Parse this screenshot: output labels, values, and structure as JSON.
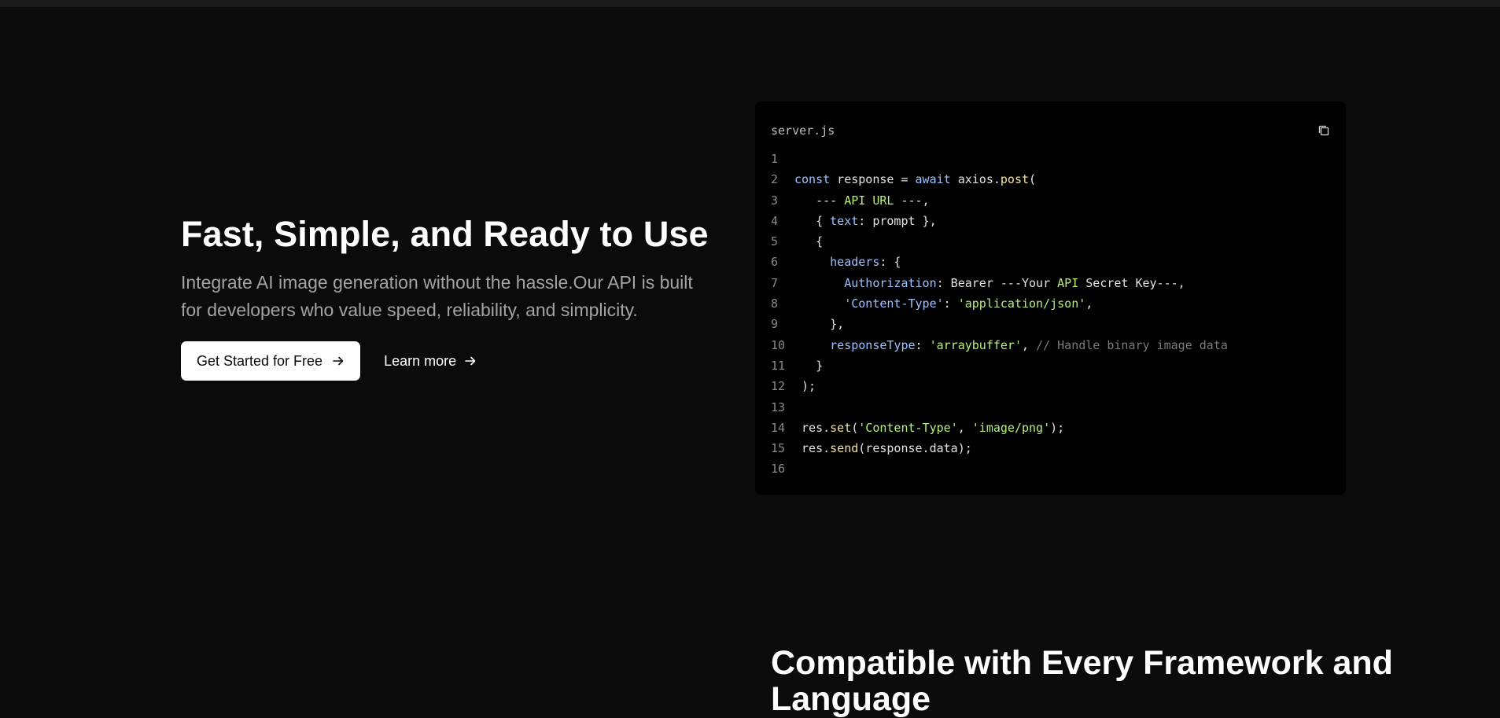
{
  "hero": {
    "title": "Fast, Simple, and Ready to Use",
    "subtitle": "Integrate AI image generation without the hassle.Our API is built for developers who value speed, reliability, and simplicity.",
    "primary_button": "Get Started for Free",
    "secondary_button": "Learn more"
  },
  "code_card": {
    "filename": "server.js",
    "copy_icon": "copy-icon",
    "lines": [
      {
        "n": "1",
        "tokens": []
      },
      {
        "n": "2",
        "tokens": [
          [
            "kw",
            "const"
          ],
          [
            "plain",
            " response = "
          ],
          [
            "kw",
            "await"
          ],
          [
            "plain",
            " axios."
          ],
          [
            "fn",
            "post"
          ],
          [
            "plain",
            "("
          ]
        ]
      },
      {
        "n": "3",
        "tokens": [
          [
            "plain",
            "   --- "
          ],
          [
            "api",
            "API URL"
          ],
          [
            "plain",
            " ---,"
          ]
        ]
      },
      {
        "n": "4",
        "tokens": [
          [
            "plain",
            "   { "
          ],
          [
            "prop",
            "text"
          ],
          [
            "plain",
            ": prompt },"
          ]
        ]
      },
      {
        "n": "5",
        "tokens": [
          [
            "plain",
            "   {"
          ]
        ]
      },
      {
        "n": "6",
        "tokens": [
          [
            "plain",
            "     "
          ],
          [
            "prop",
            "headers"
          ],
          [
            "plain",
            ": {"
          ]
        ]
      },
      {
        "n": "7",
        "tokens": [
          [
            "plain",
            "       "
          ],
          [
            "prop",
            "Authorization"
          ],
          [
            "plain",
            ": Bearer ---Your "
          ],
          [
            "api",
            "API"
          ],
          [
            "plain",
            " Secret Key---,"
          ]
        ]
      },
      {
        "n": "8",
        "tokens": [
          [
            "plain",
            "       "
          ],
          [
            "prop",
            "'Content-Type'"
          ],
          [
            "plain",
            ": "
          ],
          [
            "str",
            "'application/json'"
          ],
          [
            "plain",
            ","
          ]
        ]
      },
      {
        "n": "9",
        "tokens": [
          [
            "plain",
            "     },"
          ]
        ]
      },
      {
        "n": "10",
        "tokens": [
          [
            "plain",
            "     "
          ],
          [
            "prop",
            "responseType"
          ],
          [
            "plain",
            ": "
          ],
          [
            "str",
            "'arraybuffer'"
          ],
          [
            "plain",
            ", "
          ],
          [
            "cmt",
            "// Handle binary image data"
          ]
        ]
      },
      {
        "n": "11",
        "tokens": [
          [
            "plain",
            "   }"
          ]
        ]
      },
      {
        "n": "12",
        "tokens": [
          [
            "plain",
            " );"
          ]
        ]
      },
      {
        "n": "13",
        "tokens": []
      },
      {
        "n": "14",
        "tokens": [
          [
            "plain",
            " res."
          ],
          [
            "fn",
            "set"
          ],
          [
            "plain",
            "("
          ],
          [
            "str",
            "'Content-Type'"
          ],
          [
            "plain",
            ", "
          ],
          [
            "str",
            "'image/png'"
          ],
          [
            "plain",
            ");"
          ]
        ]
      },
      {
        "n": "15",
        "tokens": [
          [
            "plain",
            " res."
          ],
          [
            "fn",
            "send"
          ],
          [
            "plain",
            "(response.data);"
          ]
        ]
      },
      {
        "n": "16",
        "tokens": []
      }
    ]
  },
  "section2": {
    "title": "Compatible with Every Framework and Language"
  }
}
